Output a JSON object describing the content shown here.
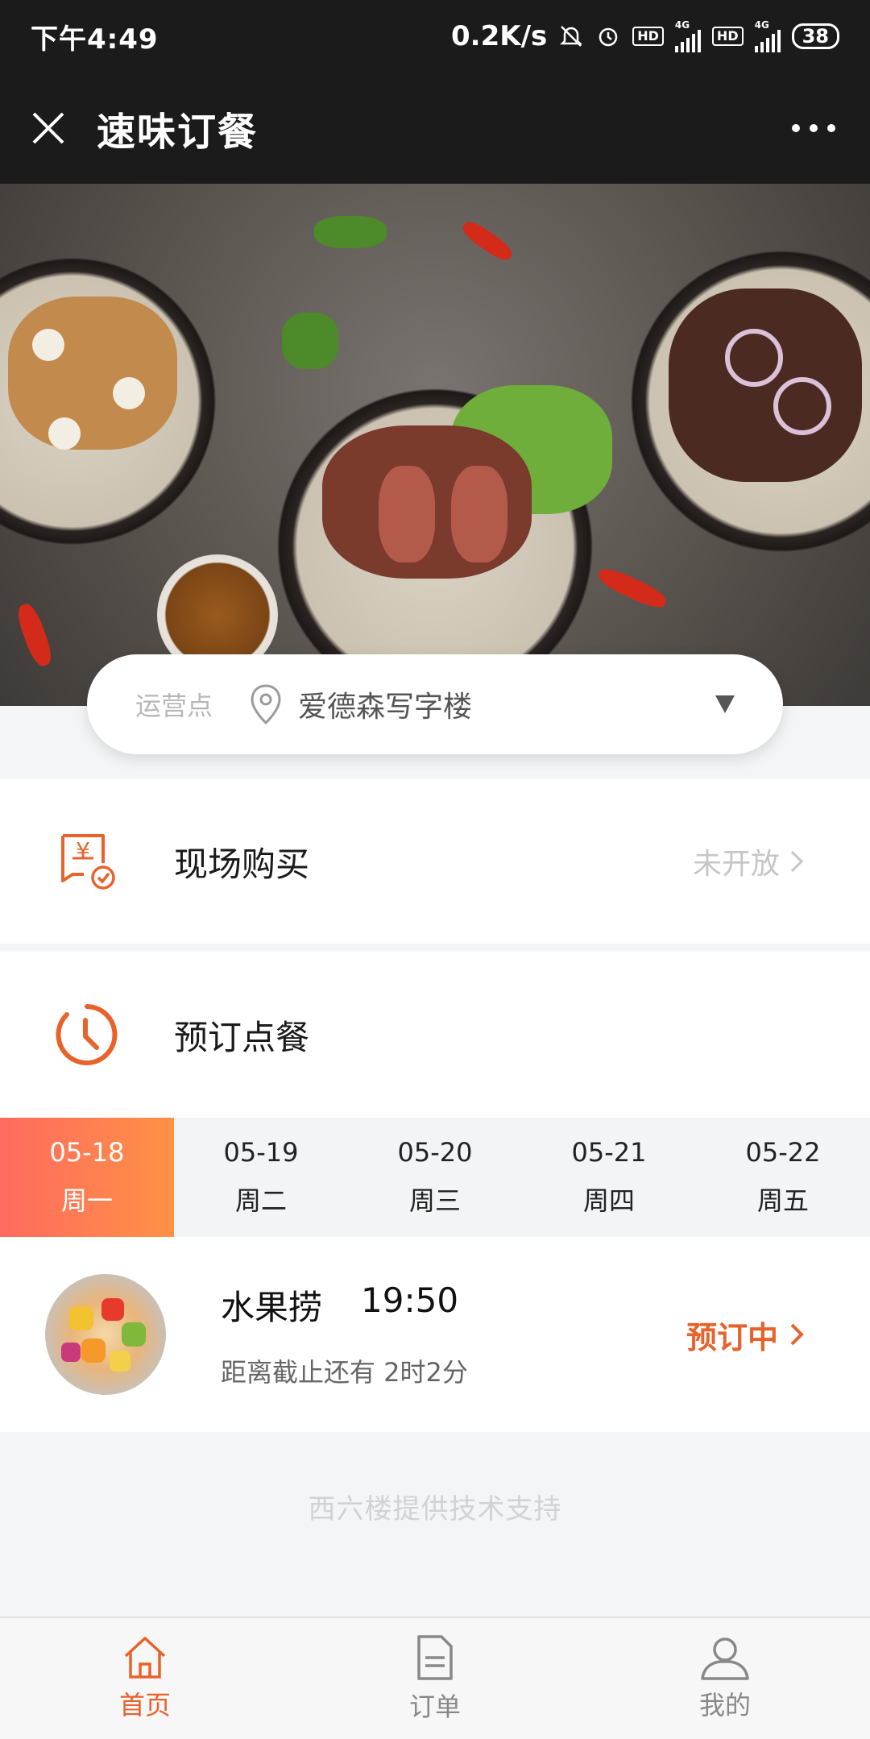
{
  "status_bar": {
    "time": "下午4:49",
    "network_speed": "0.2K/s",
    "hd1": "HD",
    "hd2": "HD",
    "net1": "4G",
    "net2": "4G",
    "battery": "38"
  },
  "title_bar": {
    "title": "速味订餐"
  },
  "location": {
    "label": "运营点",
    "value": "爱德森写字楼"
  },
  "onsite_purchase": {
    "title": "现场购买",
    "status": "未开放"
  },
  "reservation": {
    "title": "预订点餐"
  },
  "dates": [
    {
      "date": "05-18",
      "weekday": "周一",
      "active": true
    },
    {
      "date": "05-19",
      "weekday": "周二",
      "active": false
    },
    {
      "date": "05-20",
      "weekday": "周三",
      "active": false
    },
    {
      "date": "05-21",
      "weekday": "周四",
      "active": false
    },
    {
      "date": "05-22",
      "weekday": "周五",
      "active": false
    }
  ],
  "meal": {
    "name": "水果捞",
    "time": "19:50",
    "countdown": "距离截止还有 2时2分",
    "action": "预订中"
  },
  "footer_note": "西六楼提供技术支持",
  "tabs": [
    {
      "label": "首页",
      "icon": "home-icon",
      "active": true
    },
    {
      "label": "订单",
      "icon": "order-icon",
      "active": false
    },
    {
      "label": "我的",
      "icon": "profile-icon",
      "active": false
    }
  ],
  "colors": {
    "accent": "#e8622b",
    "active_date_gradient_start": "#ff6b5f",
    "active_date_gradient_end": "#ff9145",
    "header_bg": "#1b1b1b"
  }
}
